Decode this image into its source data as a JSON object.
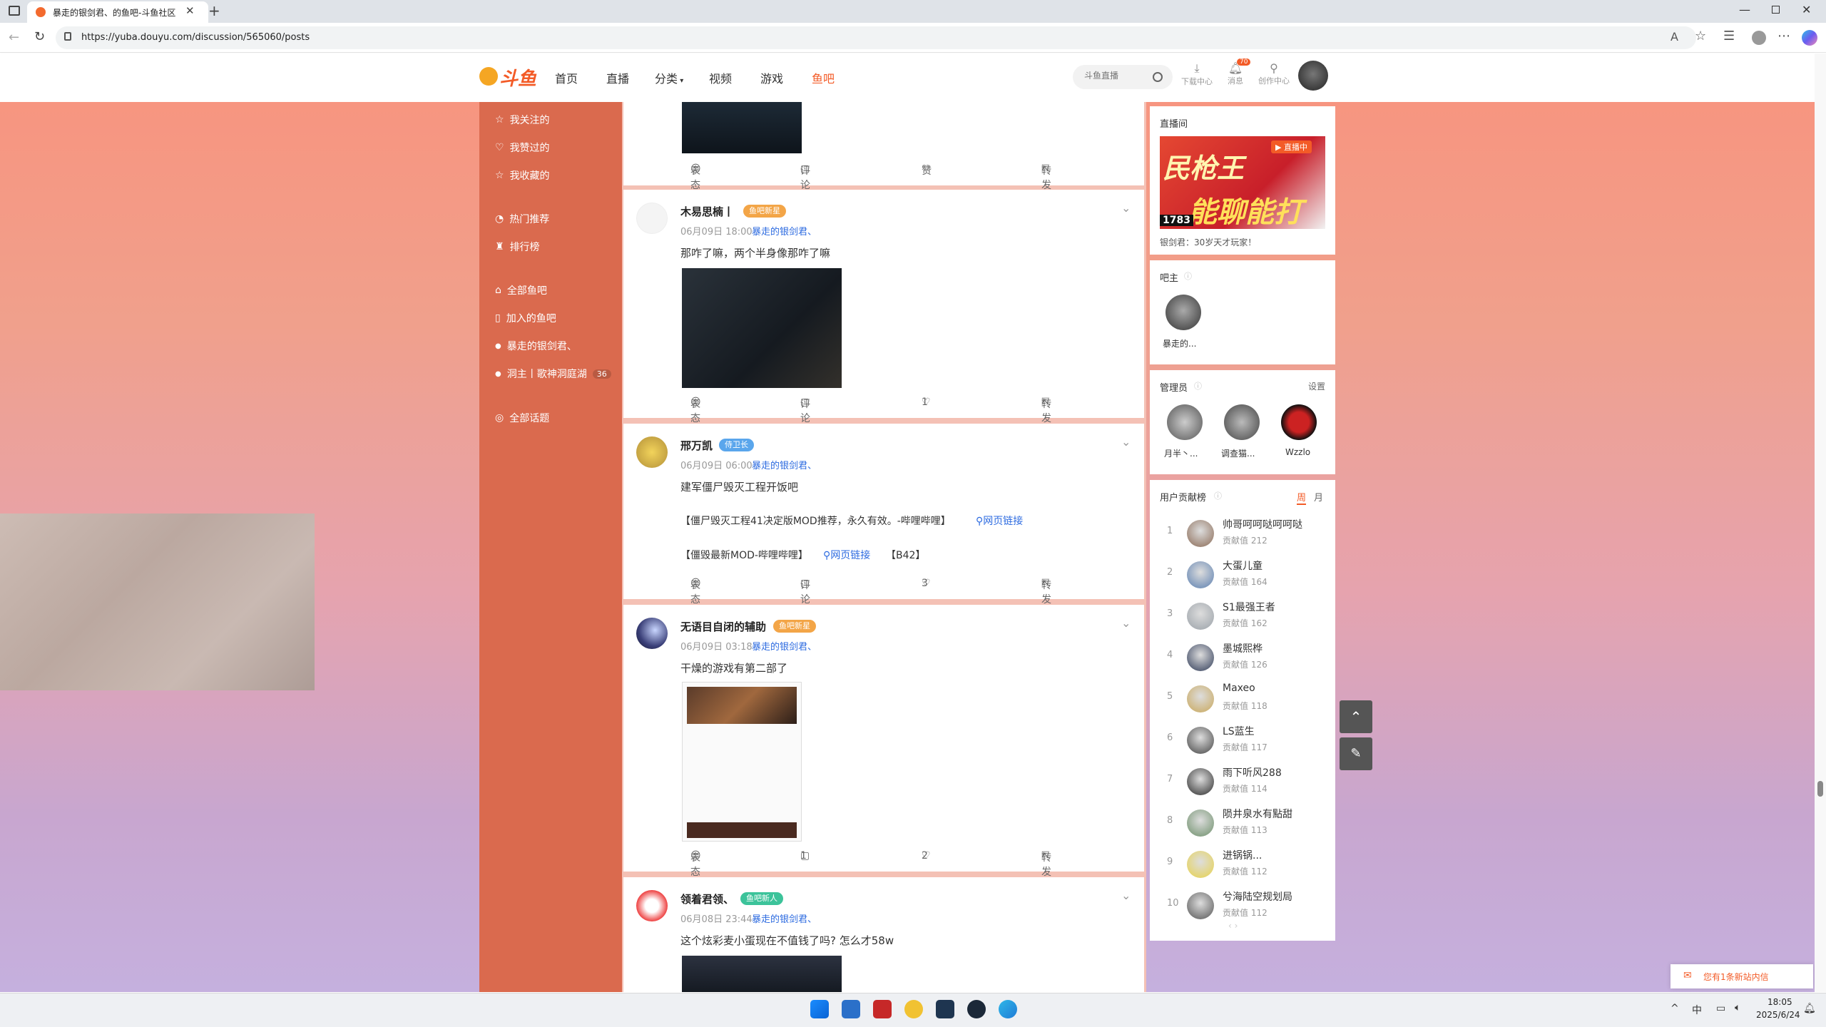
{
  "browser": {
    "tab_title": "暴走的银剑君、的鱼吧-斗鱼社区",
    "url": "https://yuba.douyu.com/discussion/565060/posts"
  },
  "header": {
    "logo": "斗鱼",
    "nav": [
      "首页",
      "直播",
      "分类",
      "视频",
      "游戏",
      "鱼吧"
    ],
    "search_placeholder": "斗鱼直播",
    "icons": [
      {
        "label": "下载中心",
        "icon": "download-icon"
      },
      {
        "label": "消息",
        "icon": "bell-icon",
        "badge": "70"
      },
      {
        "label": "创作中心",
        "icon": "lightbulb-icon"
      }
    ]
  },
  "left_nav": {
    "items": [
      "我关注的",
      "我赞过的",
      "我收藏的",
      "热门推荐",
      "排行榜",
      "全部鱼吧",
      "加入的鱼吧"
    ],
    "joined": [
      {
        "name": "暴走的银剑君、"
      },
      {
        "name": "洞主丨歌神洞庭湖",
        "count": "36"
      }
    ],
    "all_topics": "全部话题"
  },
  "actions": {
    "react": "表态",
    "comment": "评论",
    "like": "赞",
    "share": "转发"
  },
  "posts": [
    {
      "author": "木易思楠丨",
      "badge": "鱼吧新星",
      "time": "06月09日 18:00",
      "group": "暴走的银剑君、",
      "text": "那咋了嘛，两个半身像那咋了嘛",
      "comments": "评论",
      "likes": "1"
    },
    {
      "author": "邢万凯",
      "badge": "侍卫长",
      "time": "06月09日 06:00",
      "group": "暴走的银剑君、",
      "text": "建军僵尸毁灭工程开饭吧",
      "line1": "【僵尸毁灭工程41决定版MOD推荐，永久有效。-哔哩哔哩】",
      "line2": "【僵毁最新MOD-哔哩哔哩】",
      "link": "网页链接",
      "line2_suffix": "【B42】",
      "comments": "评论",
      "likes": "3"
    },
    {
      "author": "无语目自闭的辅助",
      "badge": "鱼吧新星",
      "time": "06月09日 03:18",
      "group": "暴走的银剑君、",
      "text": "干燥的游戏有第二部了",
      "comments": "1",
      "likes": "2"
    },
    {
      "author": "领着君领、",
      "badge": "鱼吧新人",
      "time": "06月08日 23:44",
      "group": "暴走的银剑君、",
      "text": "这个炫彩麦小蛋现在不值钱了吗? 怎么才58w"
    }
  ],
  "sidebar": {
    "live": {
      "title": "直播间",
      "badge": "直播中",
      "thumb_text1": "民枪王",
      "thumb_text2": "能聊能打",
      "thumb_num": "1783",
      "caption": "银剑君：30岁天才玩家！"
    },
    "owner": {
      "title": "吧主",
      "name": "暴走的..."
    },
    "admins": {
      "title": "管理员",
      "settings": "设置",
      "names": [
        "月半丶...",
        "调查猫...",
        "Wzzlo"
      ]
    },
    "ranking": {
      "title": "用户贡献榜",
      "tab_week": "周",
      "tab_month": "月",
      "score_label": "贡献值",
      "rows": [
        {
          "rank": "1",
          "name": "帅哥呵呵哒呵呵哒",
          "score": "212"
        },
        {
          "rank": "2",
          "name": "大蛋儿童",
          "score": "164"
        },
        {
          "rank": "3",
          "name": "S1最强王者",
          "score": "162"
        },
        {
          "rank": "4",
          "name": "墨城熙桦",
          "score": "126"
        },
        {
          "rank": "5",
          "name": "Maxeo",
          "score": "118"
        },
        {
          "rank": "6",
          "name": "LS蓝生",
          "score": "117"
        },
        {
          "rank": "7",
          "name": "雨下听风288",
          "score": "114"
        },
        {
          "rank": "8",
          "name": "陨井泉水有點甜",
          "score": "113"
        },
        {
          "rank": "9",
          "name": "进锅锅...",
          "score": "112"
        },
        {
          "rank": "10",
          "name": "兮海陆空规划局",
          "score": "112"
        }
      ]
    }
  },
  "notification": "您有1条新站内信",
  "taskbar": {
    "ime": "中",
    "time": "18:05",
    "date": "2025/6/24"
  }
}
